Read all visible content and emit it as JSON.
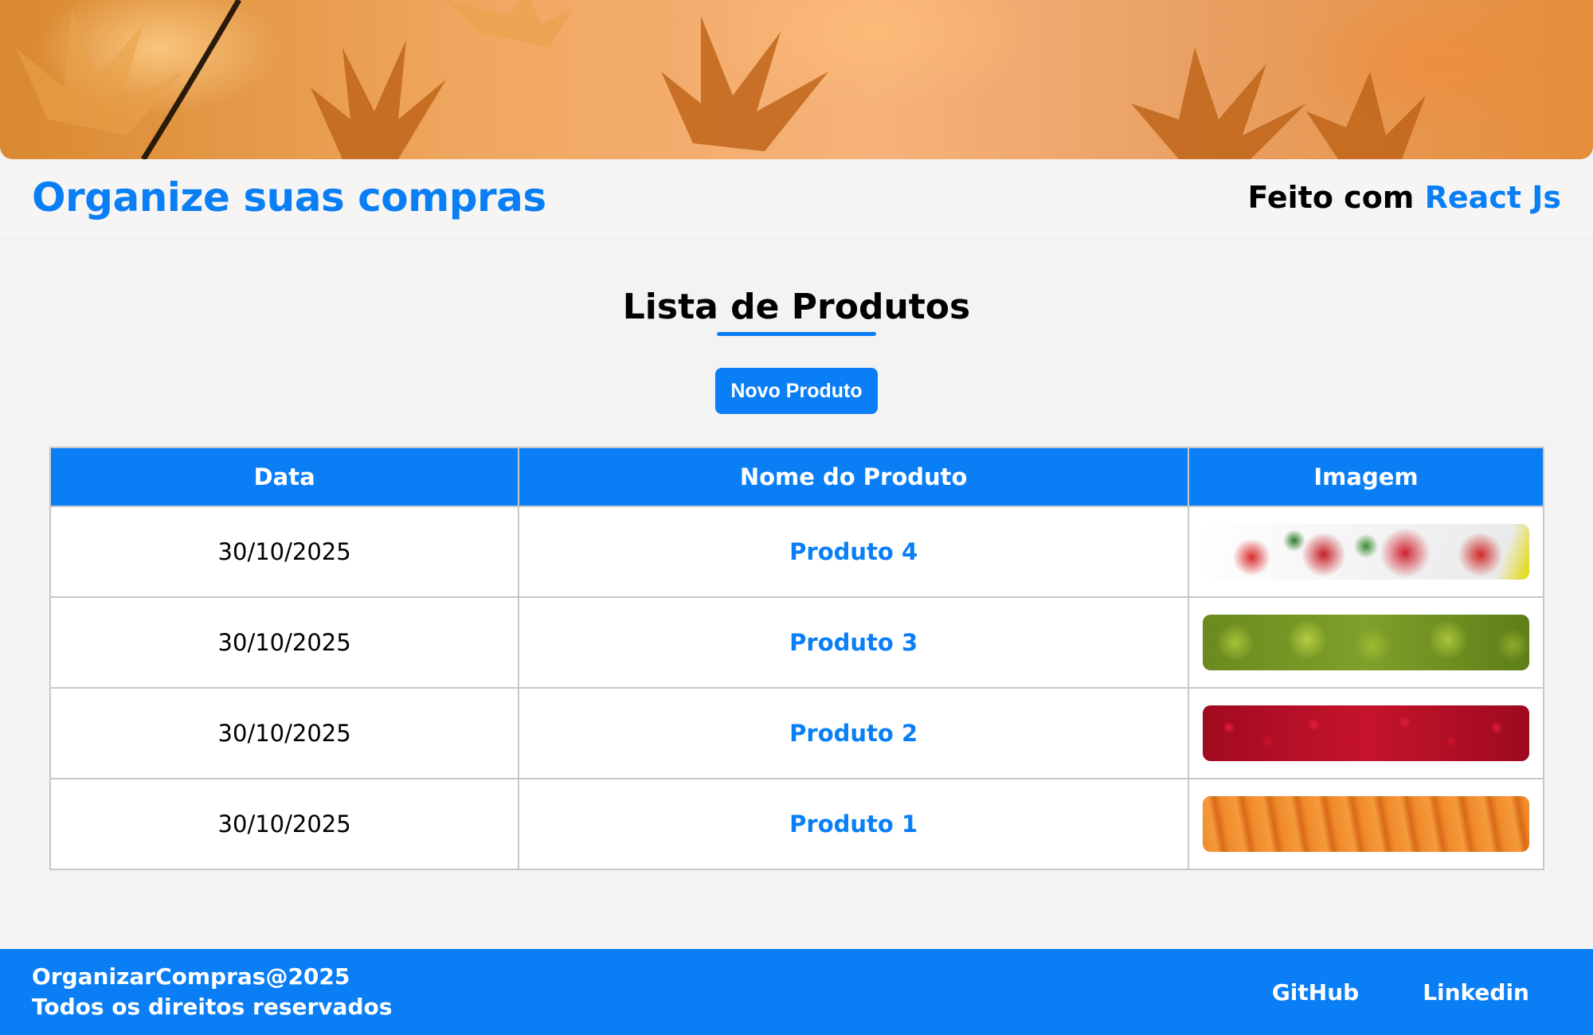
{
  "header": {
    "title": "Organize suas compras",
    "made_with_prefix": "Feito com",
    "made_with_tech": "React Js"
  },
  "main": {
    "heading": "Lista de Produtos",
    "new_button_label": "Novo Produto",
    "table": {
      "columns": [
        "Data",
        "Nome do Produto",
        "Imagem"
      ],
      "rows": [
        {
          "date": "30/10/2025",
          "name": "Produto 4",
          "image": "strawberries"
        },
        {
          "date": "30/10/2025",
          "name": "Produto 3",
          "image": "pears"
        },
        {
          "date": "30/10/2025",
          "name": "Produto 2",
          "image": "cherries"
        },
        {
          "date": "30/10/2025",
          "name": "Produto 1",
          "image": "carrots"
        }
      ]
    }
  },
  "footer": {
    "line1": "OrganizarCompras@2025",
    "line2": "Todos os direitos reservados",
    "links": [
      "GitHub",
      "Linkedin"
    ]
  },
  "colors": {
    "accent": "#0a7ff5",
    "background": "#f3f3f3"
  }
}
